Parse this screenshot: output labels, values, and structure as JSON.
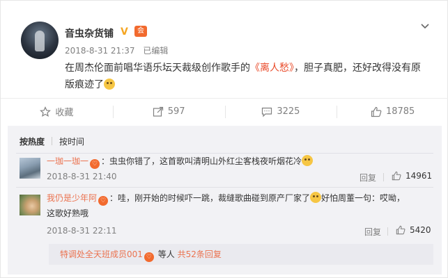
{
  "post": {
    "username": "音虫杂货铺",
    "member_badge": "会",
    "time": "2018-8-31 21:37",
    "edited": "已编辑",
    "text_before": "在周杰伦面前唱华语乐坛天裁级创作歌手的",
    "song_title": "《离人愁》",
    "text_after": "，胆子真肥，还好改得没有原版痕迹了"
  },
  "actions": [
    {
      "label": "收藏",
      "icon": "star-icon"
    },
    {
      "label": "597",
      "icon": "share-icon"
    },
    {
      "label": "3225",
      "icon": "comment-icon"
    },
    {
      "label": "18785",
      "icon": "thumbs-up-icon"
    }
  ],
  "comments_panel": {
    "sort_hot": "按热度",
    "sort_time": "按时间",
    "items": [
      {
        "name": "一珈一珈一",
        "text": "：虫虫你错了，这首歌叫清明山外红尘客栈夜听烟花冷",
        "time": "2018-8-31 21:40",
        "reply": "回复",
        "likes": "14961"
      },
      {
        "name": "我仍是少年阿",
        "text_line1": "：哇，刚开始的时候吓一跳，裁缝歌曲碰到原产厂家了",
        "text_line1_b": "好怕周董一句：哎呦，",
        "text_line2": "这歌好熟哦",
        "time": "2018-8-31 22:11",
        "reply": "回复",
        "likes": "5420"
      }
    ],
    "sub_reply": {
      "name": "特调处全天班成员001",
      "middle": "等人",
      "count": "共52条回复"
    }
  }
}
